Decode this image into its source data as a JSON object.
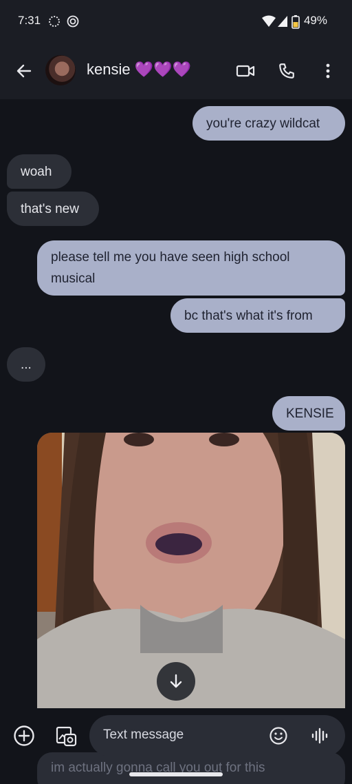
{
  "status_bar": {
    "time": "7:31",
    "battery_percent": "49%"
  },
  "app_bar": {
    "contact_name": "kensie 💜💜💜"
  },
  "messages": [
    {
      "type": "sent",
      "text": "you're crazy wildcat"
    },
    {
      "type": "received",
      "text": "woah"
    },
    {
      "type": "received",
      "text": "that's new"
    },
    {
      "type": "sent",
      "text": "please tell me you have seen high school musical"
    },
    {
      "type": "sent",
      "text": "bc that's what it's from"
    },
    {
      "type": "received",
      "text": "..."
    },
    {
      "type": "sent",
      "text": "KENSIE"
    }
  ],
  "partial_message": "im actually gonna call you out for this",
  "composer": {
    "placeholder": "Text message"
  },
  "colors": {
    "background": "#12141a",
    "sent_bubble": "#a9b0c9",
    "received_bubble": "#2c2f37",
    "bar": "#1b1d24"
  }
}
